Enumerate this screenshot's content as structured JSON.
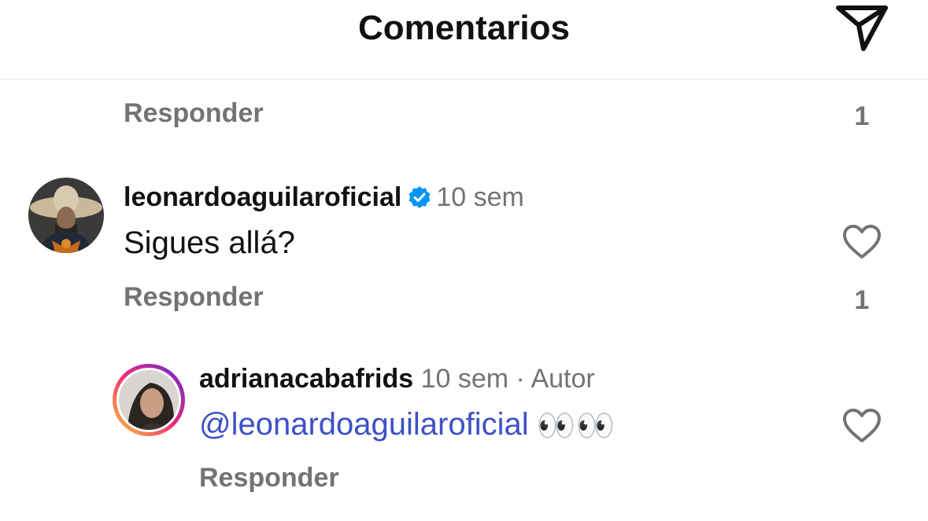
{
  "header": {
    "title": "Comentarios",
    "send_icon": "send-icon"
  },
  "prev_comment": {
    "reply_label": "Responder",
    "like_count": "1"
  },
  "comment1": {
    "username": "leonardoaguilaroficial",
    "verified": true,
    "time": "10 sem",
    "text": "Sigues allá?",
    "reply_label": "Responder",
    "like_count": "1"
  },
  "reply1": {
    "username": "adrianacabafrids",
    "time": "10 sem",
    "separator": "·",
    "author_badge": "Autor",
    "mention": "@leonardoaguilaroficial",
    "emoji": "👀👀",
    "reply_label": "Responder"
  },
  "colors": {
    "text_primary": "#111111",
    "text_secondary": "#737373",
    "mention": "#3d50c8",
    "verified": "#0095f6",
    "story_ring_start": "#f9ce34",
    "story_ring_mid": "#ee2a7b",
    "story_ring_end": "#6228d7"
  }
}
